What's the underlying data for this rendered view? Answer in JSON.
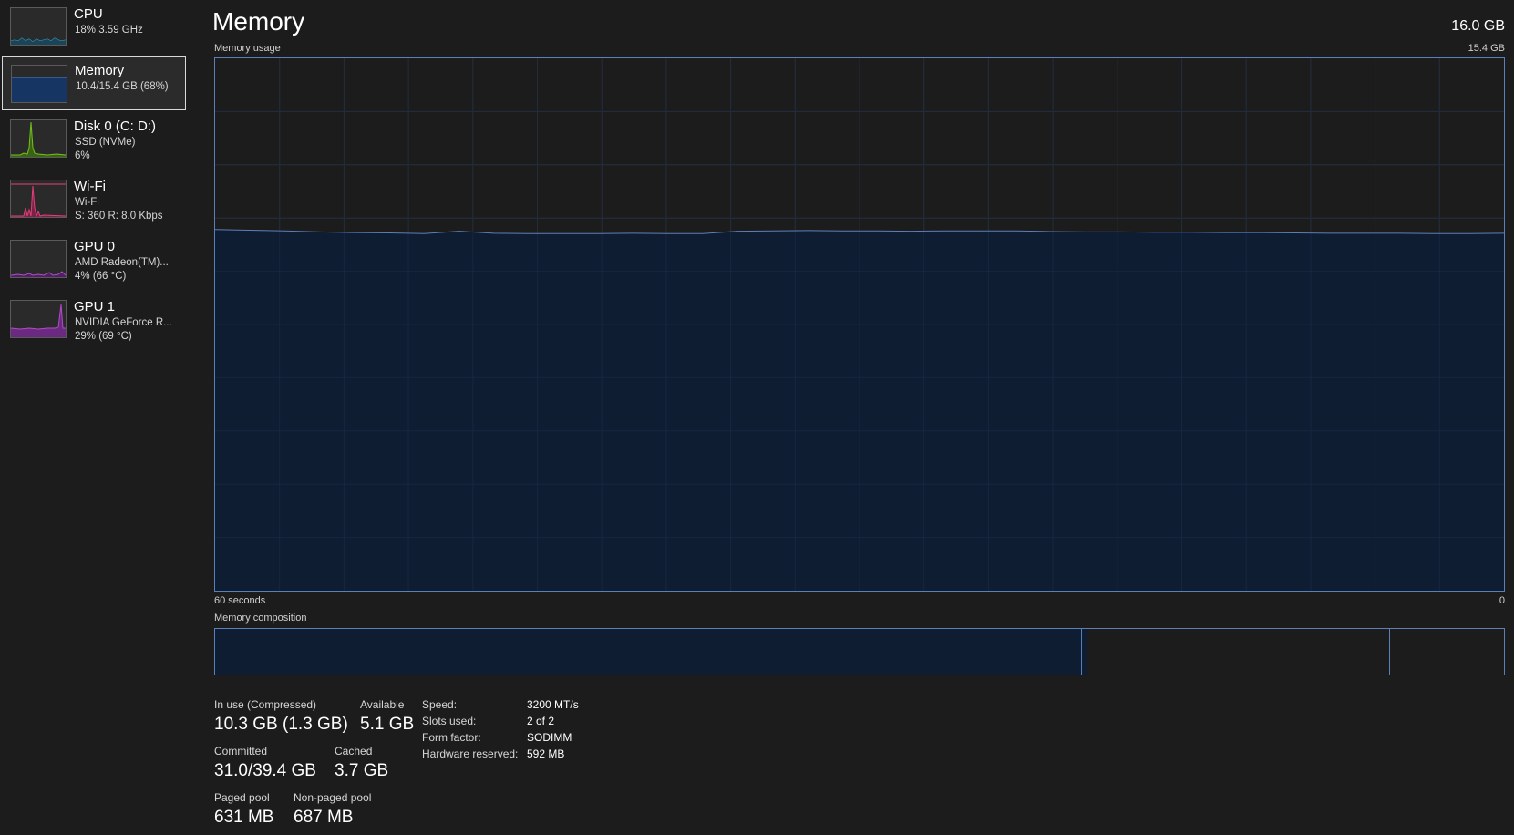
{
  "sidebar": {
    "items": [
      {
        "title": "CPU",
        "line1": "18%  3.59 GHz",
        "line2": "",
        "color": "#2aa6d8",
        "selected": false
      },
      {
        "title": "Memory",
        "line1": "10.4/15.4 GB (68%)",
        "line2": "",
        "color": "#5b80b8",
        "selected": true
      },
      {
        "title": "Disk 0 (C: D:)",
        "line1": "SSD (NVMe)",
        "line2": "6%",
        "color": "#74c01c",
        "selected": false
      },
      {
        "title": "Wi-Fi",
        "line1": "Wi-Fi",
        "line2": "S: 360  R: 8.0 Kbps",
        "color": "#e0407a",
        "selected": false
      },
      {
        "title": "GPU 0",
        "line1": "AMD Radeon(TM)...",
        "line2": "4%  (66 °C)",
        "color": "#b04cc8",
        "selected": false
      },
      {
        "title": "GPU 1",
        "line1": "NVIDIA GeForce R...",
        "line2": "29%  (69 °C)",
        "color": "#b04cc8",
        "selected": false
      }
    ]
  },
  "header": {
    "title": "Memory",
    "total": "16.0 GB"
  },
  "graph": {
    "label": "Memory usage",
    "max_label": "15.4 GB",
    "x_left_label": "60 seconds",
    "x_right_label": "0",
    "line_color": "#5b80b8",
    "fill_color": "#0f1d33"
  },
  "chart_data": {
    "type": "area",
    "ylim": [
      0,
      15.4
    ],
    "x_range_seconds": [
      60,
      0
    ],
    "grid": true,
    "values_gb": [
      10.45,
      10.43,
      10.41,
      10.38,
      10.36,
      10.35,
      10.33,
      10.4,
      10.34,
      10.33,
      10.33,
      10.33,
      10.34,
      10.33,
      10.33,
      10.4,
      10.41,
      10.42,
      10.41,
      10.41,
      10.4,
      10.41,
      10.41,
      10.41,
      10.39,
      10.38,
      10.38,
      10.37,
      10.37,
      10.36,
      10.36,
      10.35,
      10.34,
      10.34,
      10.34,
      10.33,
      10.33,
      10.34
    ]
  },
  "composition": {
    "label": "Memory composition",
    "segments": [
      {
        "name": "in-use",
        "fraction": 0.672
      },
      {
        "name": "modified",
        "fraction": 0.004
      },
      {
        "name": "standby",
        "fraction": 0.235
      },
      {
        "name": "free",
        "fraction": 0.089
      }
    ]
  },
  "stats": {
    "in_use_label": "In use (Compressed)",
    "in_use_value": "10.3 GB (1.3 GB)",
    "available_label": "Available",
    "available_value": "5.1 GB",
    "committed_label": "Committed",
    "committed_value": "31.0/39.4 GB",
    "cached_label": "Cached",
    "cached_value": "3.7 GB",
    "paged_label": "Paged pool",
    "paged_value": "631 MB",
    "nonpaged_label": "Non-paged pool",
    "nonpaged_value": "687 MB"
  },
  "properties": {
    "speed_label": "Speed:",
    "speed_value": "3200 MT/s",
    "slots_label": "Slots used:",
    "slots_value": "2 of 2",
    "form_label": "Form factor:",
    "form_value": "SODIMM",
    "hw_label": "Hardware reserved:",
    "hw_value": "592 MB"
  }
}
